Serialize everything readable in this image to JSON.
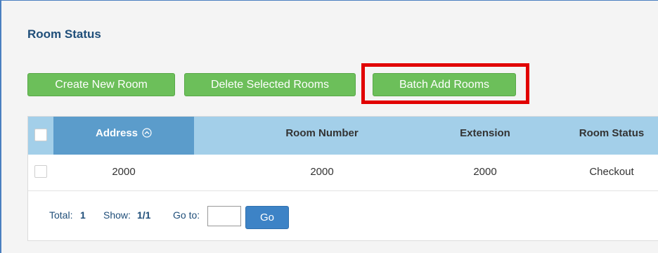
{
  "page": {
    "title": "Room Status"
  },
  "toolbar": {
    "create_label": "Create New Room",
    "delete_label": "Delete Selected Rooms",
    "batch_label": "Batch Add Rooms"
  },
  "table": {
    "columns": [
      "Address",
      "Room Number",
      "Extension",
      "Room Status"
    ],
    "sort_icon": "chevron-up-circle-icon",
    "rows": [
      {
        "address": "2000",
        "room_number": "2000",
        "extension": "2000",
        "status": "Checkout"
      }
    ]
  },
  "pagination": {
    "total_label": "Total:",
    "total_value": "1",
    "show_label": "Show:",
    "show_value": "1/1",
    "goto_label": "Go to:",
    "goto_value": "",
    "go_label": "Go"
  },
  "colors": {
    "green_button": "#6cbf5a",
    "header_bg": "#a3cfe9",
    "header_active": "#5b9ccb",
    "go_button": "#3d83c6",
    "highlight": "#e10000"
  }
}
